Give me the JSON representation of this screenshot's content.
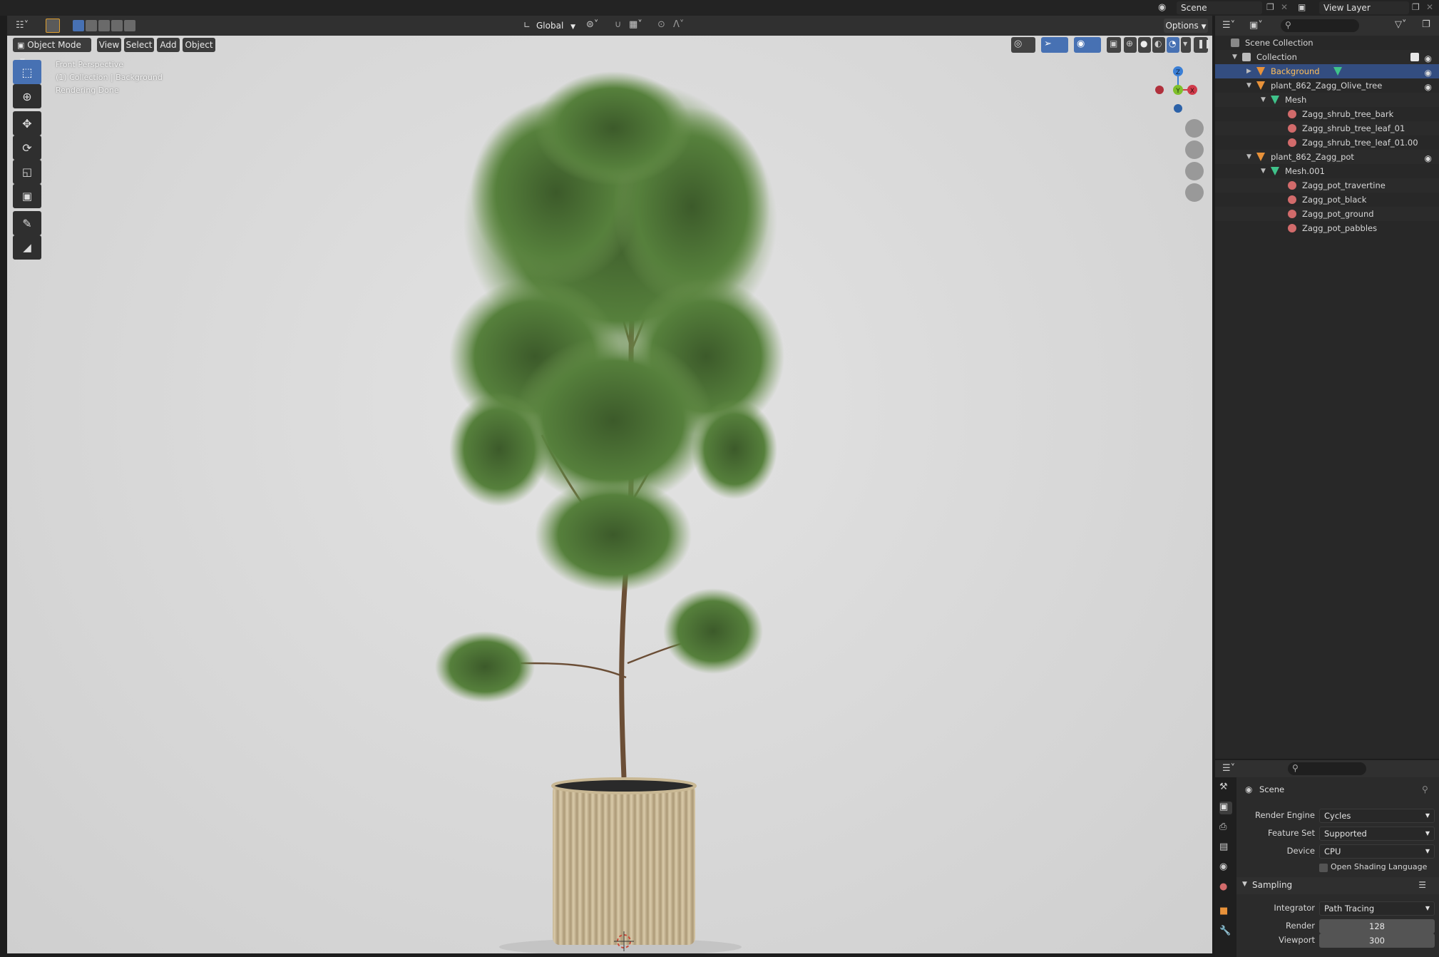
{
  "topbar": {
    "scene_label": "Scene",
    "view_layer_label": "View Layer"
  },
  "viewport_header": {
    "mode": "Object Mode",
    "menus": [
      "View",
      "Select",
      "Add",
      "Object"
    ],
    "orientation": "Global",
    "options": "Options"
  },
  "overlay": {
    "line1": "Front Perspective",
    "line2": "(1) Collection | Background",
    "line3": "Rendering Done"
  },
  "gizmo": {
    "x": "X",
    "y": "Y",
    "z": "Z"
  },
  "outliner": {
    "scene_collection": "Scene Collection",
    "collection": "Collection",
    "background": "Background",
    "olive_tree": "plant_862_Zagg_Olive_tree",
    "mesh": "Mesh",
    "mat_bark": "Zagg_shrub_tree_bark",
    "mat_leaf1": "Zagg_shrub_tree_leaf_01",
    "mat_leaf2": "Zagg_shrub_tree_leaf_01.00",
    "pot": "plant_862_Zagg_pot",
    "mesh001": "Mesh.001",
    "mat_travertine": "Zagg_pot_travertine",
    "mat_black": "Zagg_pot_black",
    "mat_ground": "Zagg_pot_ground",
    "mat_pabbles": "Zagg_pot_pabbles"
  },
  "properties": {
    "context": "Scene",
    "render_engine_label": "Render Engine",
    "render_engine": "Cycles",
    "feature_set_label": "Feature Set",
    "feature_set": "Supported",
    "device_label": "Device",
    "device": "CPU",
    "osl_label": "Open Shading Language",
    "sampling_label": "Sampling",
    "integrator_label": "Integrator",
    "integrator": "Path Tracing",
    "render_label": "Render",
    "render_samples": "128",
    "viewport_label": "Viewport",
    "viewport_samples": "300"
  },
  "colors": {
    "selection": "#334d80",
    "active_tool": "#4771b3",
    "axis_x": "#d03a4a",
    "axis_y": "#7fbf2a",
    "axis_z": "#3a7fd6",
    "object_icon": "#e8923a",
    "mesh_icon": "#3fc28a",
    "material_icon": "#d26b6b"
  }
}
